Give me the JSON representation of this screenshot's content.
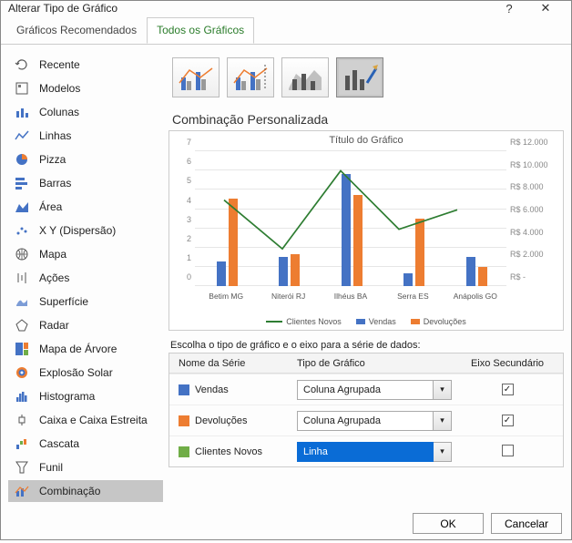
{
  "window": {
    "title": "Alterar Tipo de Gráfico",
    "help": "?",
    "close": "✕"
  },
  "tabs": {
    "recommended": "Gráficos Recomendados",
    "all": "Todos os Gráficos"
  },
  "sidebar": {
    "items": [
      "Recente",
      "Modelos",
      "Colunas",
      "Linhas",
      "Pizza",
      "Barras",
      "Área",
      "X Y (Dispersão)",
      "Mapa",
      "Ações",
      "Superfície",
      "Radar",
      "Mapa de Árvore",
      "Explosão Solar",
      "Histograma",
      "Caixa e Caixa Estreita",
      "Cascata",
      "Funil",
      "Combinação"
    ]
  },
  "section_title": "Combinação Personalizada",
  "preview": {
    "title": "Título do Gráfico",
    "legend": {
      "clientes": "Clientes Novos",
      "vendas": "Vendas",
      "dev": "Devoluções"
    }
  },
  "instruction": "Escolha o tipo de gráfico e o eixo para a série de dados:",
  "table": {
    "col_name": "Nome da Série",
    "col_type": "Tipo de Gráfico",
    "col_sec": "Eixo Secundário",
    "rows": [
      {
        "name": "Vendas",
        "type": "Coluna Agrupada",
        "sec": true,
        "color": "#4472c4",
        "active": false
      },
      {
        "name": "Devoluções",
        "type": "Coluna Agrupada",
        "sec": true,
        "color": "#ed7d31",
        "active": false
      },
      {
        "name": "Clientes Novos",
        "type": "Linha",
        "sec": false,
        "color": "#70ad47",
        "active": true
      }
    ]
  },
  "footer": {
    "ok": "OK",
    "cancel": "Cancelar"
  },
  "chart_data": {
    "type": "combo",
    "title": "Título do Gráfico",
    "categories": [
      "Betim MG",
      "Niterói RJ",
      "Ilhéus BA",
      "Serra ES",
      "Anápolis GO"
    ],
    "primary_axis": {
      "label": "",
      "min": 0,
      "max": 7,
      "ticks": [
        0,
        1,
        2,
        3,
        4,
        5,
        6,
        7
      ]
    },
    "secondary_axis": {
      "label": "",
      "min": 0,
      "max": 12000,
      "ticks": [
        "R$ -",
        "R$ 2.000",
        "R$ 4.000",
        "R$ 6.000",
        "R$ 8.000",
        "R$ 10.000",
        "R$ 12.000"
      ]
    },
    "series": [
      {
        "name": "Vendas",
        "type": "bar",
        "axis": "secondary",
        "color": "#4472c4",
        "values": [
          2200,
          2600,
          9800,
          1100,
          2600
        ]
      },
      {
        "name": "Devoluções",
        "type": "bar",
        "axis": "secondary",
        "color": "#ed7d31",
        "values": [
          7700,
          2800,
          8000,
          5900,
          1700
        ]
      },
      {
        "name": "Clientes Novos",
        "type": "line",
        "axis": "primary",
        "color": "#2e7d32",
        "values": [
          4.5,
          2,
          6,
          3,
          4
        ]
      }
    ]
  }
}
